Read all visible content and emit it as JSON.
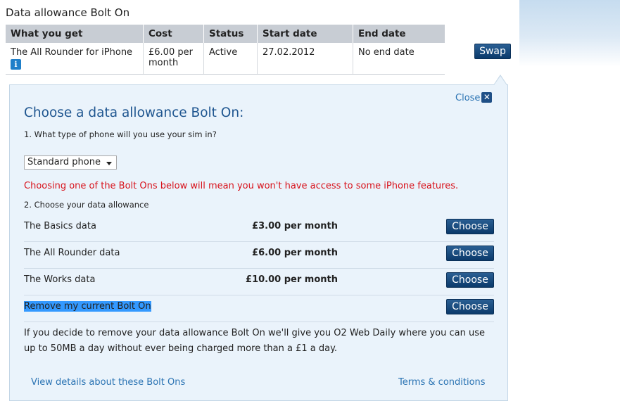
{
  "section_title": "Data allowance Bolt On",
  "table": {
    "headers": [
      "What you get",
      "Cost",
      "Status",
      "Start date",
      "End date"
    ],
    "row": {
      "what": "The All Rounder for iPhone",
      "info_icon_glyph": "i",
      "cost": "£6.00 per month",
      "status": "Active",
      "start": "27.02.2012",
      "end": "No end date"
    }
  },
  "swap_label": "Swap",
  "panel": {
    "close_label": "Close",
    "close_glyph": "✕",
    "heading": "Choose a data allowance Bolt On:",
    "step1": "1. What type of phone will you use your sim in?",
    "phone_select_value": "Standard phone",
    "warning": "Choosing one of the Bolt Ons below will mean you won't have access to some iPhone features.",
    "step2": "2. Choose your data allowance",
    "options": [
      {
        "label": "The Basics data",
        "price": "£3.00 per month",
        "button": "Choose"
      },
      {
        "label": "The All Rounder data",
        "price": "£6.00 per month",
        "button": "Choose"
      },
      {
        "label": "The Works data",
        "price": "£10.00 per month",
        "button": "Choose"
      },
      {
        "label": "Remove my current Bolt On",
        "price": "",
        "button": "Choose"
      }
    ],
    "remove_info": "If you decide to remove your data allowance Bolt On we'll give you O2 Web Daily where you can use up to 50MB a day without ever being charged more than a £1 a day.",
    "details_link": "View details about these Bolt Ons",
    "terms_link": "Terms & conditions"
  },
  "colors": {
    "button": "#0b3a6b",
    "heading": "#1f5690",
    "warning": "#d8121b",
    "link": "#2a73b3",
    "panel_bg": "#eaf3fb"
  }
}
